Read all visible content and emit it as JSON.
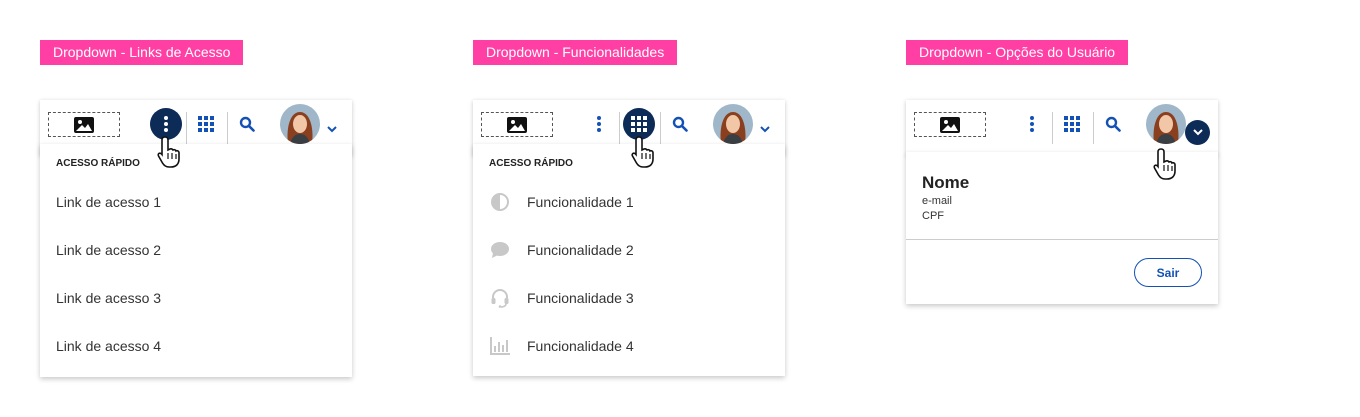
{
  "panels": [
    {
      "tag": "Dropdown - Links de Acesso",
      "menu_header": "ACESSO RÁPIDO",
      "items": [
        "Link de acesso 1",
        "Link de acesso 2",
        "Link de acesso 3",
        "Link de acesso 4"
      ]
    },
    {
      "tag": "Dropdown - Funcionalidades",
      "menu_header": "ACESSO RÁPIDO",
      "items": [
        {
          "label": "Funcionalidade 1",
          "icon": "contrast-icon"
        },
        {
          "label": "Funcionalidade 2",
          "icon": "chat-bubble-icon"
        },
        {
          "label": "Funcionalidade 3",
          "icon": "headset-icon"
        },
        {
          "label": "Funcionalidade 4",
          "icon": "bar-chart-icon"
        }
      ]
    },
    {
      "tag": "Dropdown - Opções do Usuário",
      "user": {
        "name": "Nome",
        "email": "e-mail",
        "cpf": "CPF"
      },
      "logout_label": "Sair"
    }
  ],
  "colors": {
    "tag": "#ff3fa4",
    "primary": "#1351b4",
    "active": "#0c2b57",
    "muted_icon": "#c8c8c8"
  }
}
